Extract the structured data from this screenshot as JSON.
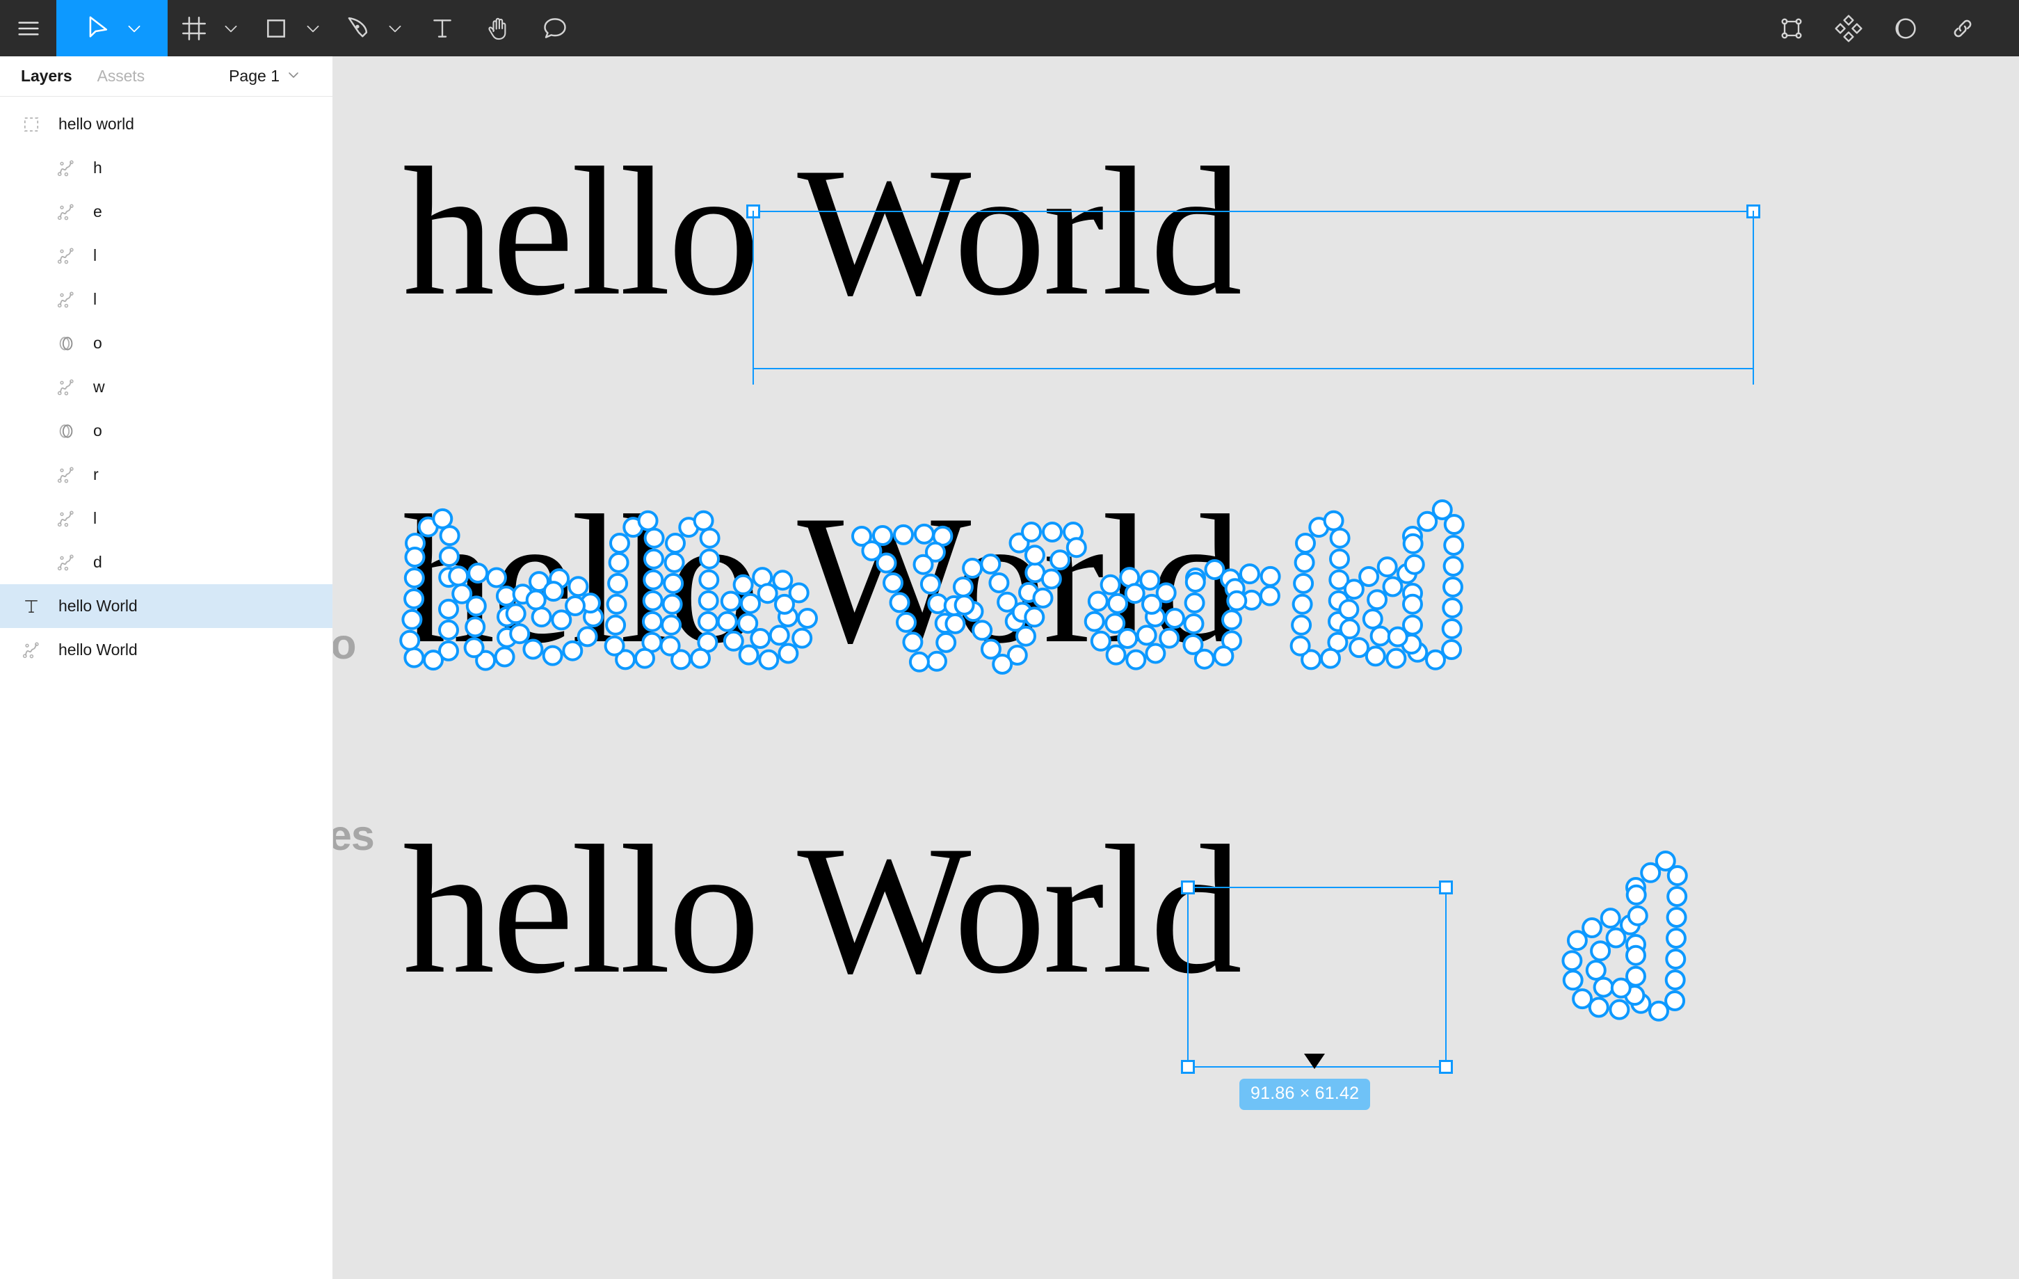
{
  "toolbar": {
    "left_tools": [
      {
        "name": "menu-icon",
        "label": "Main menu",
        "icon": "hamburger",
        "has_caret": false,
        "active": false
      },
      {
        "name": "move-tool",
        "label": "Move",
        "icon": "cursor",
        "has_caret": true,
        "active": true
      },
      {
        "name": "frame-tool",
        "label": "Frame",
        "icon": "frame",
        "has_caret": true,
        "active": false
      },
      {
        "name": "shape-tool",
        "label": "Rectangle",
        "icon": "square",
        "has_caret": true,
        "active": false
      },
      {
        "name": "pen-tool",
        "label": "Pen",
        "icon": "pen",
        "has_caret": true,
        "active": false
      },
      {
        "name": "text-tool",
        "label": "Text",
        "icon": "text-t",
        "has_caret": false,
        "active": false
      },
      {
        "name": "hand-tool",
        "label": "Hand",
        "icon": "hand",
        "has_caret": false,
        "active": false
      },
      {
        "name": "comment-tool",
        "label": "Comment",
        "icon": "comment-bubble",
        "has_caret": false,
        "active": false
      }
    ],
    "right_tools": [
      {
        "name": "component-icon",
        "label": "Create component",
        "icon": "component"
      },
      {
        "name": "components-grid-icon",
        "label": "Components",
        "icon": "diamonds"
      },
      {
        "name": "mask-icon",
        "label": "Use as mask",
        "icon": "half-circle"
      },
      {
        "name": "link-icon",
        "label": "Link",
        "icon": "link"
      }
    ],
    "accent_color": "#0d99ff",
    "background_color": "#2c2c2c"
  },
  "sidebar": {
    "tabs": [
      {
        "label": "Layers",
        "active": true
      },
      {
        "label": "Assets",
        "active": false
      }
    ],
    "page_selector": {
      "label": "Page 1",
      "caret": "chevron-down-icon"
    },
    "layers": [
      {
        "label": "hello world",
        "icon": "group-dashed-icon",
        "depth": 0,
        "selected": false
      },
      {
        "label": "h",
        "icon": "vector-path-icon",
        "depth": 1,
        "selected": false
      },
      {
        "label": "e",
        "icon": "vector-path-icon",
        "depth": 1,
        "selected": false
      },
      {
        "label": "l",
        "icon": "vector-path-icon",
        "depth": 1,
        "selected": false
      },
      {
        "label": "l",
        "icon": "vector-path-icon",
        "depth": 1,
        "selected": false
      },
      {
        "label": "o",
        "icon": "boolean-union-icon",
        "depth": 1,
        "selected": false
      },
      {
        "label": "w",
        "icon": "vector-path-icon",
        "depth": 1,
        "selected": false
      },
      {
        "label": "o",
        "icon": "boolean-union-icon",
        "depth": 1,
        "selected": false
      },
      {
        "label": "r",
        "icon": "vector-path-icon",
        "depth": 1,
        "selected": false
      },
      {
        "label": "l",
        "icon": "vector-path-icon",
        "depth": 1,
        "selected": false
      },
      {
        "label": "d",
        "icon": "vector-path-icon",
        "depth": 1,
        "selected": false
      },
      {
        "label": "hello World",
        "icon": "text-layer-icon",
        "depth": 0,
        "selected": true
      },
      {
        "label": "hello World",
        "icon": "vector-path-icon",
        "depth": 0,
        "selected": false
      }
    ],
    "selected_row_color": "#d6e8f7"
  },
  "canvas": {
    "background_color": "#e5e5e5",
    "rows": [
      {
        "name": "row-top",
        "label": "",
        "artwork_text": "hello World",
        "state": "selected-bounds"
      },
      {
        "name": "row-no",
        "label": "no",
        "artwork_text": "hello World",
        "state": "vector-nodes-all"
      },
      {
        "name": "row-yes",
        "label": "yes",
        "artwork_text": "hello World",
        "state": "partial-selection"
      }
    ],
    "dimension_badge": "91.86 × 61.42",
    "selection_color": "#0d99ff",
    "node_fill": "#ffffff",
    "badge_color": "#6fc2f7",
    "label_color": "#a6a6a6"
  }
}
